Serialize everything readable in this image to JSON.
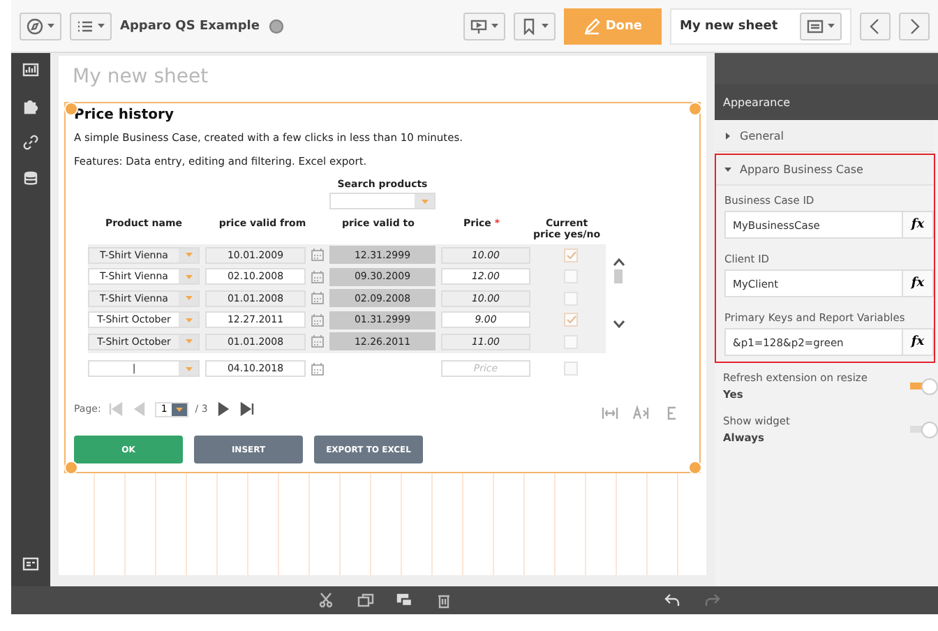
{
  "toolbar": {
    "app_title": "Apparo QS Example",
    "done_label": "Done",
    "sheet_name": "My new sheet"
  },
  "sheet": {
    "title": "My new sheet"
  },
  "widget": {
    "title": "Price history",
    "description": "A simple Business Case, created with a few clicks in less than 10 minutes.",
    "features": "Features: Data entry, editing and filtering. Excel export.",
    "search_label": "Search products",
    "columns": [
      {
        "label": "Product name"
      },
      {
        "label": "price valid from"
      },
      {
        "label": "price valid to"
      },
      {
        "label": "Price",
        "required_mark": "*"
      },
      {
        "label": "Current price yes/no"
      }
    ],
    "rows": [
      {
        "product": "T-Shirt Vienna",
        "valid_from": "10.01.2009",
        "valid_to": "12.31.2999",
        "price": "10.00",
        "current": true,
        "editable": false
      },
      {
        "product": "T-Shirt Vienna",
        "valid_from": "02.10.2008",
        "valid_to": "09.30.2009",
        "price": "12.00",
        "current": false,
        "editable": true
      },
      {
        "product": "T-Shirt Vienna",
        "valid_from": "01.01.2008",
        "valid_to": "02.09.2008",
        "price": "10.00",
        "current": false,
        "editable": false
      },
      {
        "product": "T-Shirt October",
        "valid_from": "12.27.2011",
        "valid_to": "01.31.2999",
        "price": "9.00",
        "current": true,
        "editable": true
      },
      {
        "product": "T-Shirt October",
        "valid_from": "01.01.2008",
        "valid_to": "12.26.2011",
        "price": "11.00",
        "current": false,
        "editable": false
      }
    ],
    "new_row": {
      "product": "|",
      "valid_from": "04.10.2018",
      "price_placeholder": "Price",
      "current": false
    },
    "pager": {
      "label": "Page:",
      "page": "1",
      "total": "/ 3"
    },
    "buttons": [
      {
        "label": "OK",
        "kind": "primary"
      },
      {
        "label": "INSERT",
        "kind": "secondary"
      },
      {
        "label": "EXPORT TO EXCEL",
        "kind": "secondary"
      }
    ]
  },
  "panel": {
    "header": "Appearance",
    "sections": [
      {
        "label": "General",
        "expanded": false,
        "highlighted": false
      },
      {
        "label": "Apparo Business Case",
        "expanded": true,
        "highlighted": true,
        "fields": [
          {
            "label": "Business Case ID",
            "value": "MyBusinessCase",
            "function_label": "fx"
          },
          {
            "label": "Client ID",
            "value": "MyClient",
            "function_label": "fx"
          },
          {
            "label": "Primary Keys and Report Variables",
            "value": "&p1=128&p2=green",
            "function_label": "fx"
          }
        ]
      }
    ],
    "toggles": [
      {
        "label": "Refresh extension on resize",
        "value": "Yes",
        "on": true
      },
      {
        "label": "Show widget",
        "value": "Always",
        "on": false
      }
    ]
  }
}
